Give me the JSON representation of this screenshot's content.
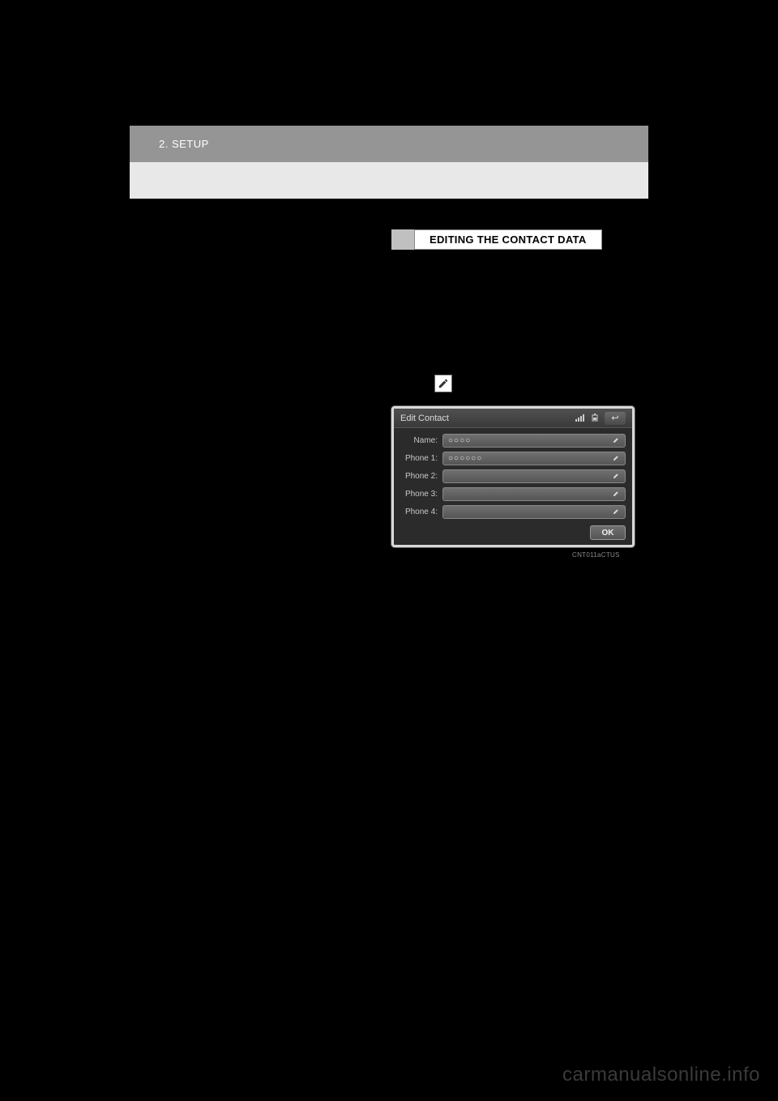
{
  "header": {
    "breadcrumb": "2. SETUP"
  },
  "left_column": {
    "question_mark": "?"
  },
  "right_column": {
    "section_title": "EDITING THE CONTACT DATA",
    "pencil_icon_name": "edit-pencil-icon"
  },
  "screen": {
    "title": "Edit Contact",
    "caption": "CNT011aCTUS",
    "back_label": "↩",
    "rows": [
      {
        "label": "Name:",
        "value": "○○○○"
      },
      {
        "label": "Phone 1:",
        "value": "○○○○○○"
      },
      {
        "label": "Phone 2:",
        "value": ""
      },
      {
        "label": "Phone 3:",
        "value": ""
      },
      {
        "label": "Phone 4:",
        "value": ""
      }
    ],
    "ok_label": "OK"
  },
  "watermark": "carmanualsonline.info"
}
